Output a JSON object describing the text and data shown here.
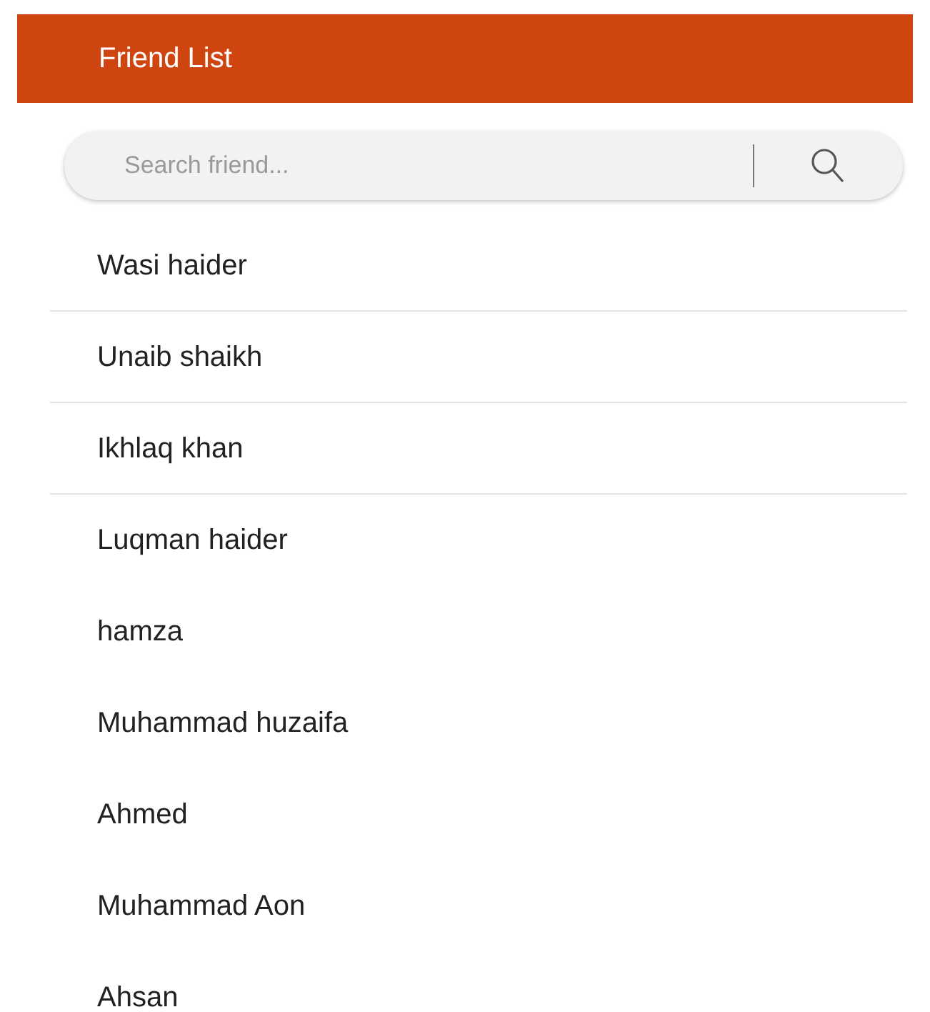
{
  "header": {
    "title": "Friend List"
  },
  "search": {
    "placeholder": "Search friend..."
  },
  "friends": [
    {
      "name": "Wasi haider",
      "divider": true
    },
    {
      "name": "Unaib shaikh",
      "divider": true
    },
    {
      "name": "Ikhlaq khan",
      "divider": true
    },
    {
      "name": "Luqman haider",
      "divider": false
    },
    {
      "name": "hamza",
      "divider": false
    },
    {
      "name": "Muhammad huzaifa",
      "divider": false
    },
    {
      "name": "Ahmed",
      "divider": false
    },
    {
      "name": "Muhammad Aon",
      "divider": false
    },
    {
      "name": "Ahsan"
    }
  ]
}
